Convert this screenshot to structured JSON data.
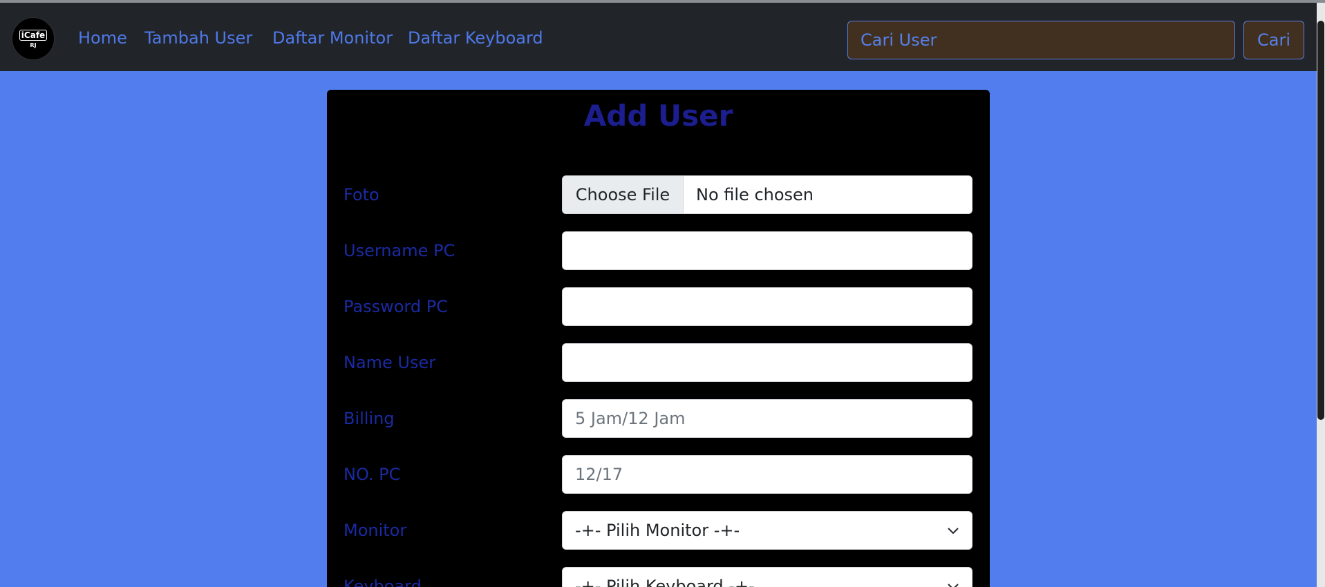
{
  "navbar": {
    "logo_text": "iCafe",
    "logo_sub": "RJ",
    "links": [
      "Home",
      "Tambah User",
      "Daftar Monitor",
      "Daftar Keyboard"
    ],
    "search": {
      "placeholder": "Cari User",
      "button_label": "Cari"
    }
  },
  "form": {
    "title": "Add User",
    "foto": {
      "label": "Foto",
      "button_label": "Choose File",
      "status": "No file chosen"
    },
    "username": {
      "label": "Username PC",
      "value": ""
    },
    "password": {
      "label": "Password PC",
      "value": ""
    },
    "name": {
      "label": "Name User",
      "value": ""
    },
    "billing": {
      "label": "Billing",
      "placeholder": "5 Jam/12 Jam"
    },
    "nopc": {
      "label": "NO. PC",
      "placeholder": "12/17"
    },
    "monitor": {
      "label": "Monitor",
      "selected": "-+- Pilih Monitor -+-"
    },
    "keyboard": {
      "label": "Keyboard",
      "selected": "-+- Pilih Keyboard -+-"
    }
  },
  "colors": {
    "page_bg": "#527def",
    "navbar_bg": "#212529",
    "nav_link": "#4f78e8",
    "card_bg": "#000000",
    "title": "#1c1e8f",
    "label": "#1b2aa3"
  }
}
